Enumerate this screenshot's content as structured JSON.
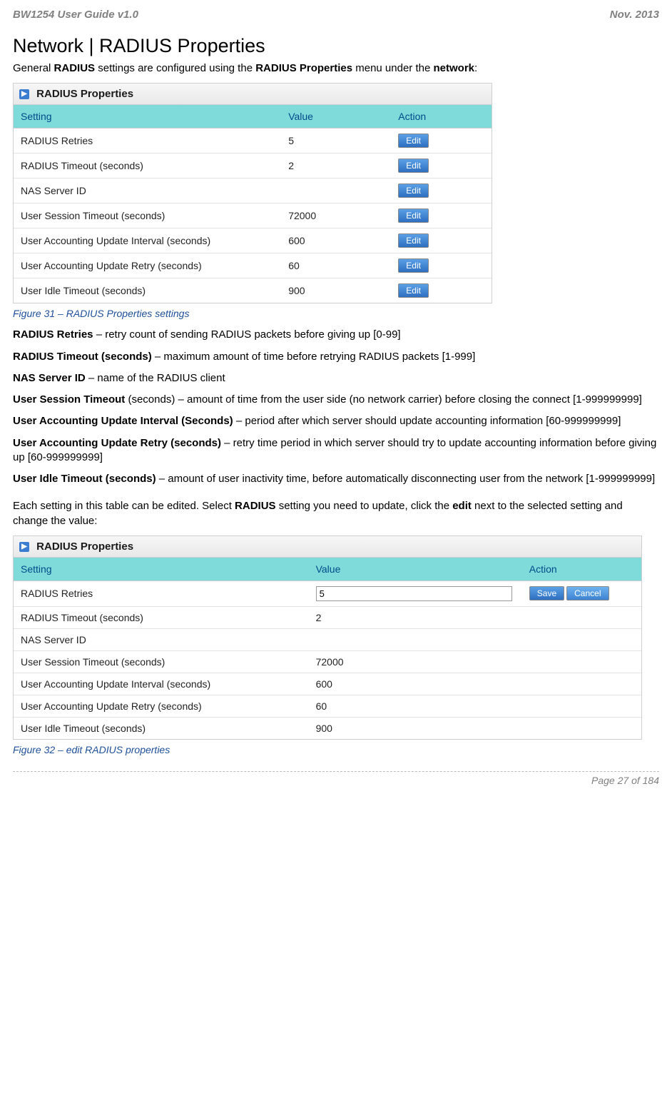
{
  "header": {
    "left": "BW1254 User Guide v1.0",
    "right": "Nov.  2013"
  },
  "title": "Network | RADIUS Properties",
  "intro": {
    "pre": "General ",
    "b1": "RADIUS",
    "mid": " settings are configured using the ",
    "b2": "RADIUS Properties",
    "mid2": " menu under the ",
    "b3": "network",
    "post": ":"
  },
  "panel1": {
    "title": "RADIUS Properties",
    "columns": {
      "setting": "Setting",
      "value": "Value",
      "action": "Action"
    },
    "edit_label": "Edit",
    "rows": [
      {
        "setting": "RADIUS Retries",
        "value": "5"
      },
      {
        "setting": "RADIUS Timeout (seconds)",
        "value": "2"
      },
      {
        "setting": "NAS Server ID",
        "value": ""
      },
      {
        "setting": "User Session Timeout (seconds)",
        "value": "72000"
      },
      {
        "setting": "User Accounting Update Interval (seconds)",
        "value": "600"
      },
      {
        "setting": "User Accounting Update Retry (seconds)",
        "value": "60"
      },
      {
        "setting": "User Idle Timeout (seconds)",
        "value": "900"
      }
    ]
  },
  "caption1": "Figure 31 – RADIUS Properties settings",
  "definitions": [
    {
      "term": "RADIUS Retries",
      "desc": " – retry count of sending RADIUS packets before giving up [0-99]"
    },
    {
      "term": "RADIUS Timeout (seconds)",
      "desc": " – maximum amount of time before retrying RADIUS packets [1-999]"
    },
    {
      "term": "NAS Server ID",
      "desc": " – name of the RADIUS client"
    },
    {
      "term": "User Session Timeout",
      "desc": " (seconds) – amount of time from the user side (no network carrier) before closing the connect [1-999999999]"
    },
    {
      "term": "User Accounting Update Interval (Seconds)",
      "desc": " – period after which server should update accounting information [60-999999999]"
    },
    {
      "term": "User Accounting Update Retry (seconds)",
      "desc": " – retry time period in which server should try to update accounting information before giving up [60-999999999]"
    },
    {
      "term": "User Idle Timeout (seconds)",
      "desc": " – amount of user inactivity time, before automatically disconnecting user from the network [1-999999999]"
    }
  ],
  "mid_para": {
    "pre": "Each setting in this table can be edited. Select ",
    "b1": "RADIUS",
    "mid": " setting you need to update, click the ",
    "b2": "edit",
    "post": " next to the selected setting and change the value:"
  },
  "panel2": {
    "title": "RADIUS Properties",
    "columns": {
      "setting": "Setting",
      "value": "Value",
      "action": "Action"
    },
    "save_label": "Save",
    "cancel_label": "Cancel",
    "edit_value": "5",
    "rows": [
      {
        "setting": "RADIUS Retries",
        "editing": true
      },
      {
        "setting": "RADIUS Timeout (seconds)",
        "value": "2"
      },
      {
        "setting": "NAS Server ID",
        "value": ""
      },
      {
        "setting": "User Session Timeout (seconds)",
        "value": "72000"
      },
      {
        "setting": "User Accounting Update Interval (seconds)",
        "value": "600"
      },
      {
        "setting": "User Accounting Update Retry (seconds)",
        "value": "60"
      },
      {
        "setting": "User Idle Timeout (seconds)",
        "value": "900"
      }
    ]
  },
  "caption2": "Figure 32 – edit RADIUS properties",
  "footer": "Page 27 of 184"
}
